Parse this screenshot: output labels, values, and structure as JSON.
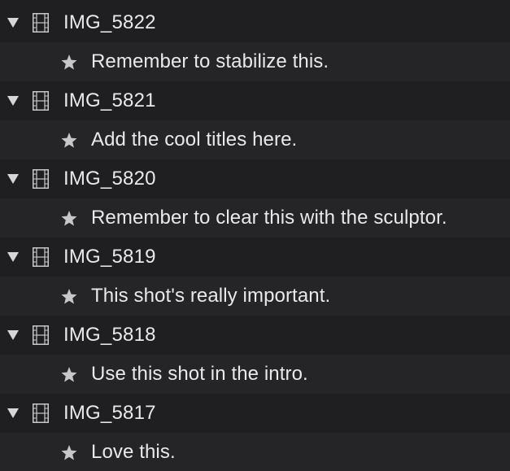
{
  "clips": [
    {
      "name": "IMG_5822",
      "note": "Remember to stabilize this."
    },
    {
      "name": "IMG_5821",
      "note": "Add the cool titles here."
    },
    {
      "name": "IMG_5820",
      "note": "Remember to clear this with the sculptor."
    },
    {
      "name": "IMG_5819",
      "note": "This shot's really important."
    },
    {
      "name": "IMG_5818",
      "note": "Use this shot in the intro."
    },
    {
      "name": "IMG_5817",
      "note": "Love this."
    }
  ],
  "icons": {
    "disclosure": "disclosure-triangle-down-icon",
    "clip": "film-strip-icon",
    "note": "star-icon"
  },
  "colors": {
    "background": "#1f1f21",
    "note_row_background": "#252527",
    "text": "#e9e9ea",
    "icon": "#c8c8ca"
  }
}
